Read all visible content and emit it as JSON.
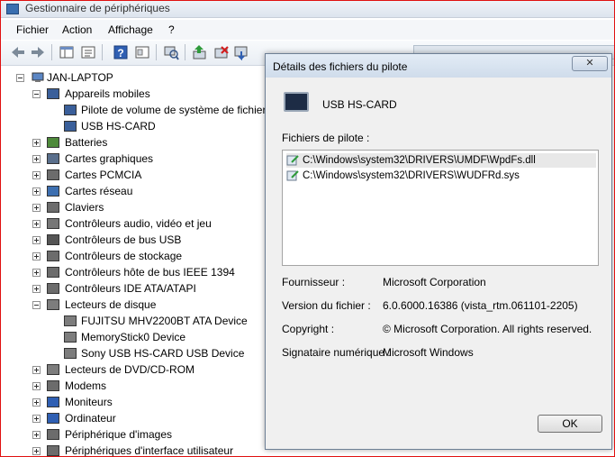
{
  "window": {
    "title": "Gestionnaire de périphériques",
    "icon": "device-manager-icon"
  },
  "menu": [
    "Fichier",
    "Action",
    "Affichage",
    "?"
  ],
  "toolbar": {
    "icons": [
      "back-arrow-icon",
      "forward-arrow-icon",
      "show-tree-icon",
      "properties-icon",
      "help-icon",
      "action-pane-icon",
      "scan-hardware-icon",
      "update-driver-icon",
      "uninstall-icon",
      "disable-device-icon"
    ]
  },
  "tree": {
    "root": "JAN-LAPTOP",
    "items": [
      {
        "label": "Appareils mobiles",
        "expanded": true,
        "icon": "portable-device-icon"
      },
      {
        "label": "Pilote de volume de système de fichier",
        "icon": "portable-device-icon"
      },
      {
        "label": "USB   HS-CARD",
        "icon": "portable-device-icon"
      },
      {
        "label": "Batteries",
        "icon": "battery-icon"
      },
      {
        "label": "Cartes graphiques",
        "icon": "display-adapter-icon"
      },
      {
        "label": "Cartes PCMCIA",
        "icon": "pcmcia-icon"
      },
      {
        "label": "Cartes réseau",
        "icon": "network-icon"
      },
      {
        "label": "Claviers",
        "icon": "keyboard-icon"
      },
      {
        "label": "Contrôleurs audio, vidéo et jeu",
        "icon": "audio-icon"
      },
      {
        "label": "Contrôleurs de bus USB",
        "icon": "usb-icon"
      },
      {
        "label": "Contrôleurs de stockage",
        "icon": "storage-controller-icon"
      },
      {
        "label": "Contrôleurs hôte de bus IEEE 1394",
        "icon": "ieee1394-icon"
      },
      {
        "label": "Contrôleurs IDE ATA/ATAPI",
        "icon": "ide-icon"
      },
      {
        "label": "Lecteurs de disque",
        "expanded": true,
        "icon": "disk-drive-icon"
      },
      {
        "label": "FUJITSU MHV2200BT ATA Device",
        "icon": "disk-drive-icon"
      },
      {
        "label": "MemoryStick0 Device",
        "icon": "disk-drive-icon"
      },
      {
        "label": "Sony USB   HS-CARD USB Device",
        "icon": "disk-drive-icon"
      },
      {
        "label": "Lecteurs de DVD/CD-ROM",
        "icon": "dvd-drive-icon"
      },
      {
        "label": "Modems",
        "icon": "modem-icon"
      },
      {
        "label": "Moniteurs",
        "icon": "monitor-icon"
      },
      {
        "label": "Ordinateur",
        "icon": "computer-icon"
      },
      {
        "label": "Périphérique d'images",
        "icon": "imaging-device-icon"
      },
      {
        "label": "Périphériques d'interface utilisateur",
        "icon": "hid-icon"
      }
    ]
  },
  "dialog": {
    "title": "Détails des fichiers du pilote",
    "close_label": "✕",
    "device_name": "USB   HS-CARD",
    "files_label": "Fichiers de pilote :",
    "files": [
      "C:\\Windows\\system32\\DRIVERS\\UMDF\\WpdFs.dll",
      "C:\\Windows\\system32\\DRIVERS\\WUDFRd.sys"
    ],
    "info": [
      {
        "label": "Fournisseur :",
        "value": "Microsoft Corporation"
      },
      {
        "label": "Version du fichier :",
        "value": "6.0.6000.16386 (vista_rtm.061101-2205)"
      },
      {
        "label": "Copyright :",
        "value": "© Microsoft Corporation. All rights reserved."
      },
      {
        "label": "Signataire numérique :",
        "value": "Microsoft Windows"
      }
    ],
    "ok_label": "OK"
  },
  "colors": {
    "frame_border": "#e01010",
    "dialog_bg": "#f0f0f0",
    "selection": "#e8e8e8"
  }
}
